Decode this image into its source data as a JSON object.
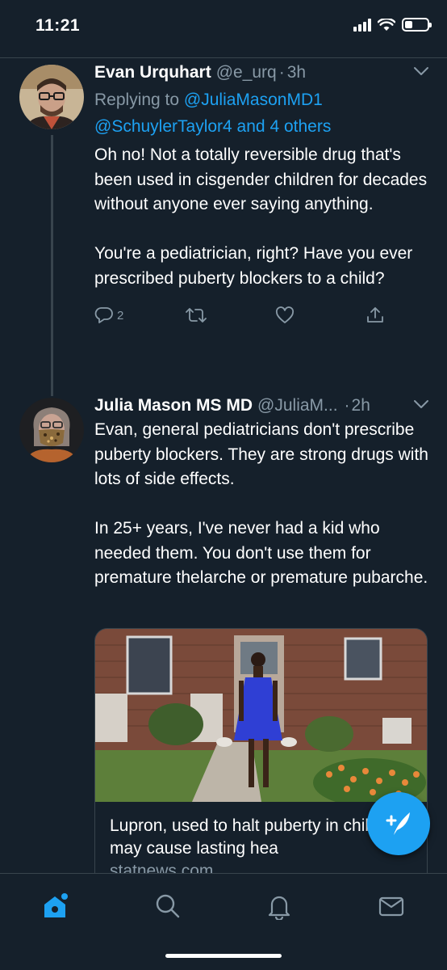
{
  "status": {
    "time": "11:21"
  },
  "tweet1": {
    "name": "Evan Urquhart",
    "handle": "@e_urq",
    "dot": "·",
    "time": "3h",
    "replying_prefix": "Replying to ",
    "replying_user1": "@JuliaMasonMD1",
    "replying_user2": "@SchuylerTaylor4",
    "replying_and": " and ",
    "replying_others": "4 others",
    "text": "Oh no! Not a totally reversible drug that's been used in cisgender children for decades without anyone ever saying anything.\n\nYou're a pediatrician, right? Have you ever prescribed puberty blockers to a child?",
    "reply_count": "2"
  },
  "tweet2": {
    "name": "Julia Mason MS MD",
    "handle": "@JuliaM...",
    "dot": "·",
    "time": "2h",
    "text": "Evan, general pediatricians don't prescribe puberty blockers.  They are strong drugs with lots of side effects.\n\nIn 25+ years, I've never had a kid who needed them.  You don't use them for premature thelarche or premature pubarche.",
    "card": {
      "title": "Lupron, used to halt puberty in children, may cause lasting hea",
      "domain": "statnews.com"
    }
  },
  "icons": {
    "chevron": "chevron-down-icon",
    "reply": "reply-icon",
    "retweet": "retweet-icon",
    "like": "heart-icon",
    "share": "share-icon",
    "compose": "compose-tweet-icon",
    "home": "home-icon",
    "search": "search-icon",
    "notifications": "bell-icon",
    "messages": "mail-icon"
  },
  "colors": {
    "background": "#15202b",
    "accent": "#1da1f2",
    "secondary_text": "#8899a6",
    "divider": "#38444d"
  }
}
